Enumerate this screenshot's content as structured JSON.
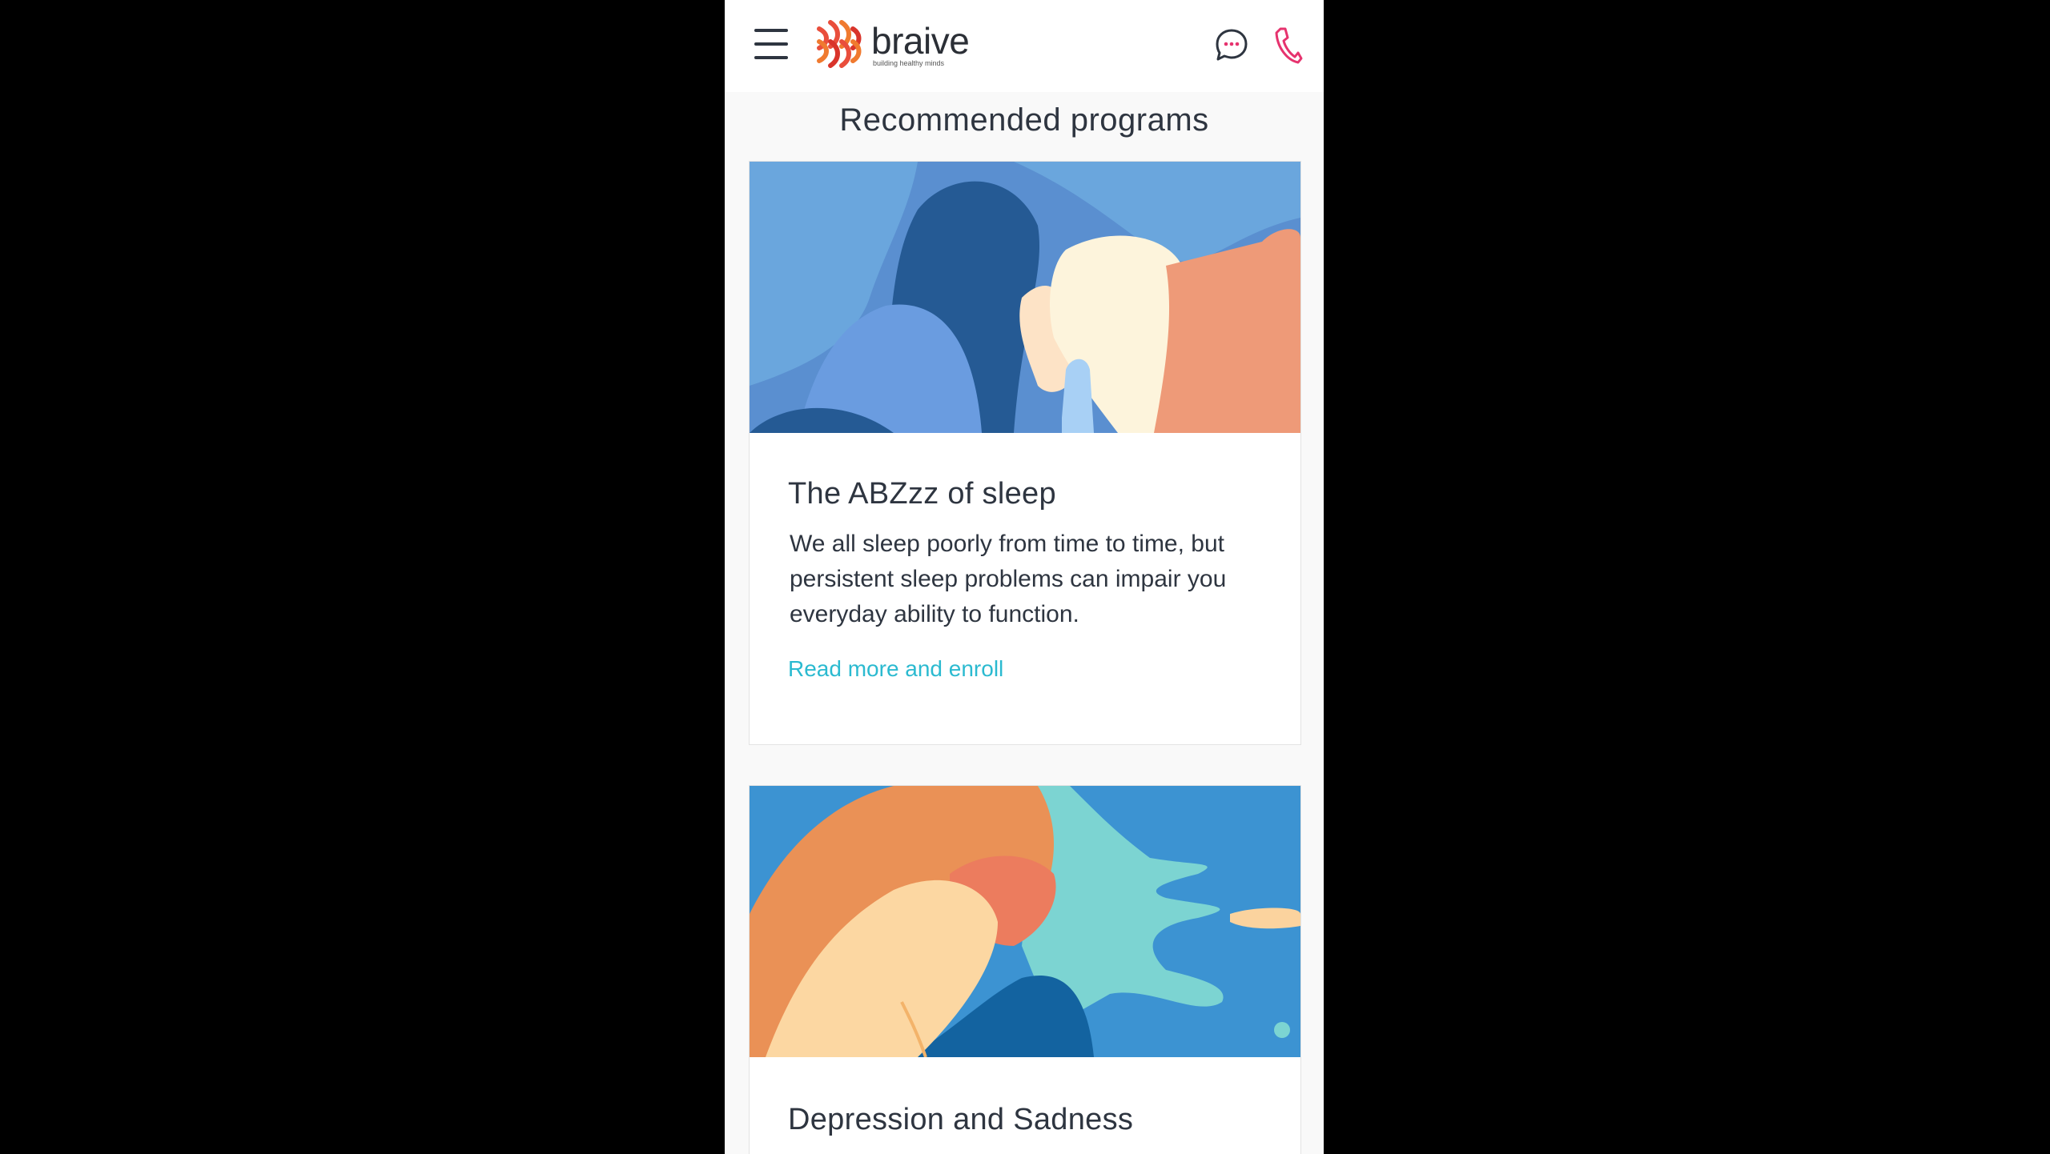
{
  "header": {
    "brand_name": "braive",
    "brand_tagline": "building healthy minds",
    "menu_icon": "hamburger-menu-icon",
    "chat_icon": "chat-bubble-icon",
    "phone_icon": "phone-icon",
    "brand_color": "#e94e3c",
    "phone_icon_color": "#e6336e"
  },
  "main": {
    "section_title": "Recommended programs",
    "programs": [
      {
        "title": "The ABZzz of sleep",
        "description": "We all sleep poorly from time to time, but persistent sleep problems can impair you everyday ability to function.",
        "link_label": "Read more and enroll"
      },
      {
        "title": "Depression and Sadness"
      }
    ]
  },
  "colors": {
    "background": "#000000",
    "page": "#f9f9f9",
    "text": "#2e3540",
    "link": "#2bbad0"
  }
}
